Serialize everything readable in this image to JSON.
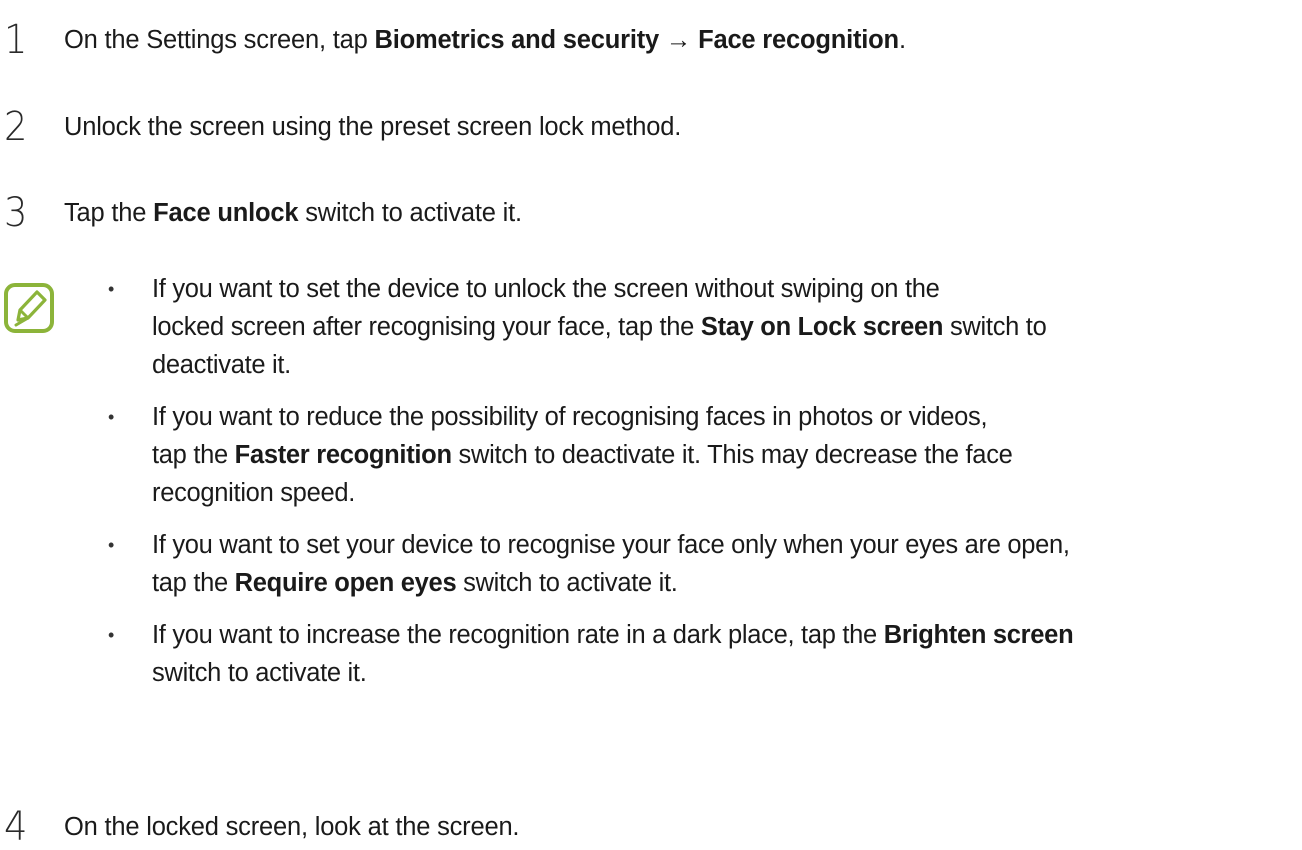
{
  "steps": [
    {
      "number": "1",
      "pre": "On the Settings screen, tap ",
      "bold1": "Biometrics and security",
      "arrow": " → ",
      "bold2": "Face recognition",
      "post": "."
    },
    {
      "number": "2",
      "text": "Unlock the screen using the preset screen lock method."
    },
    {
      "number": "3",
      "pre": "Tap the ",
      "bold": "Face unlock",
      "post": " switch to activate it."
    },
    {
      "number": "4",
      "text": "On the locked screen, look at the screen."
    }
  ],
  "note": {
    "icon": "note-pencil-icon",
    "icon_color": "#8cb43a",
    "items": [
      {
        "bullet": "•",
        "line1": "If you want to set the device to unlock the screen without swiping on the",
        "line2_pre": "locked screen after recognising your face, tap the ",
        "line2_bold": "Stay on Lock screen",
        "line2_post": " switch to",
        "line3": "deactivate it."
      },
      {
        "bullet": "•",
        "line1": "If you want to reduce the possibility of recognising faces in photos or videos,",
        "line2_pre": "tap the ",
        "line2_bold": "Faster recognition",
        "line2_post": " switch to deactivate it. This may decrease the face",
        "line3": "recognition speed."
      },
      {
        "bullet": "•",
        "line1": "If you want to set your device to recognise your face only when your eyes are open,",
        "line2_pre": "tap the ",
        "line2_bold": "Require open eyes",
        "line2_post": " switch to activate it."
      },
      {
        "bullet": "•",
        "line1_pre": "If you want to increase the recognition rate in a dark place, tap the ",
        "line1_bold": "Brighten screen",
        "line2": "switch to activate it."
      }
    ]
  }
}
